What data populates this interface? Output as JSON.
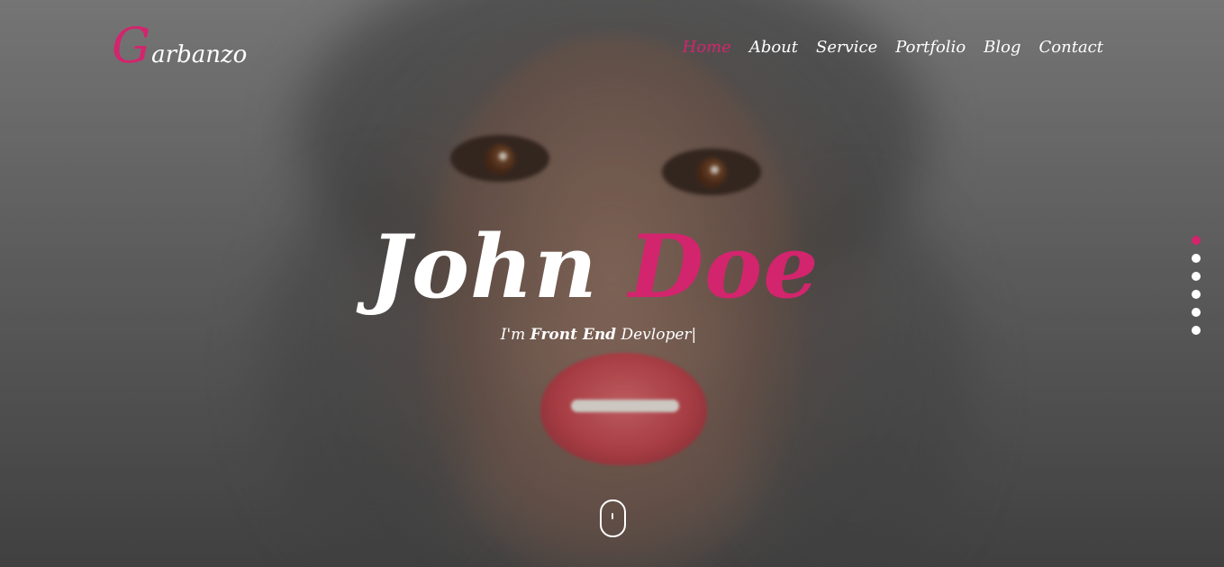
{
  "brand": {
    "initial": "G",
    "rest": "arbanzo"
  },
  "nav": {
    "items": [
      {
        "label": "Home",
        "active": true
      },
      {
        "label": "About"
      },
      {
        "label": "Service"
      },
      {
        "label": "Portfolio"
      },
      {
        "label": "Blog"
      },
      {
        "label": "Contact"
      }
    ]
  },
  "hero": {
    "first_name": "John",
    "last_name": "Doe",
    "subtitle_prefix": "I'm",
    "subtitle_role": "Front End",
    "subtitle_suffix": "Devloper|"
  },
  "pager": {
    "count": 6,
    "active_index": 0
  },
  "icons": {
    "scroll": "mouse-scroll-icon"
  },
  "colors": {
    "accent": "#d2256d",
    "text": "#ffffff"
  }
}
